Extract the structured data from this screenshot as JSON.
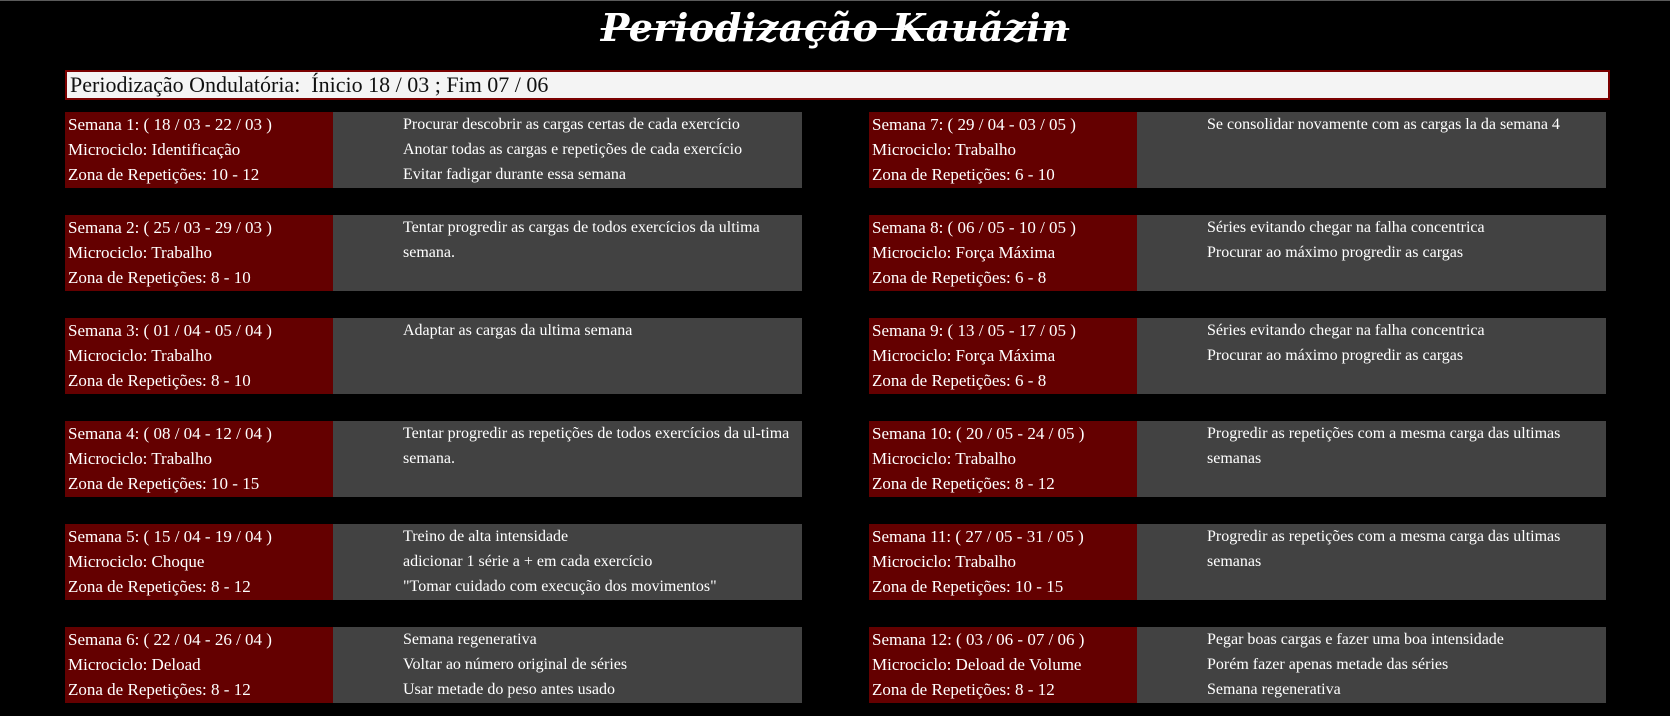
{
  "title": "Periodização Kauãzin",
  "header": "Periodização Ondulatória:  Ínicio 18 / 03 ; Fim 07 / 06",
  "weeks": [
    {
      "label": "Semana 1: ( 18 / 03 - 22 / 03 )",
      "micro": "Microciclo: Identificação",
      "zone": "Zona de Repetições: 10 - 12",
      "notes": [
        "Procurar descobrir as cargas certas de cada exercício",
        "Anotar todas as cargas e repetições de cada exercício",
        "Evitar fadigar durante essa semana"
      ]
    },
    {
      "label": "Semana 2: ( 25 / 03 - 29 / 03 )",
      "micro": "Microciclo: Trabalho",
      "zone": "Zona de Repetições: 8 - 10",
      "notes": [
        "Tentar progredir as cargas de todos exercícios da ultima semana."
      ]
    },
    {
      "label": "Semana 3: ( 01 / 04 - 05 / 04 )",
      "micro": "Microciclo: Trabalho",
      "zone": "Zona de Repetições: 8 - 10",
      "notes": [
        "Adaptar as cargas da ultima semana"
      ]
    },
    {
      "label": "Semana 4: ( 08 / 04 - 12 / 04 )",
      "micro": "Microciclo: Trabalho",
      "zone": "Zona de Repetições: 10 - 15",
      "notes": [
        "Tentar progredir as repetições de todos exercícios da ul-tima semana."
      ]
    },
    {
      "label": "Semana 5: ( 15 / 04 - 19 / 04 )",
      "micro": "Microciclo: Choque",
      "zone": "Zona de Repetições: 8 - 12",
      "notes": [
        "Treino de alta intensidade",
        "adicionar 1 série a + em cada exercício",
        "\"Tomar cuidado com execução dos movimentos\""
      ]
    },
    {
      "label": "Semana 6: ( 22 / 04 - 26 / 04 )",
      "micro": "Microciclo: Deload",
      "zone": "Zona de Repetições: 8 - 12",
      "notes": [
        "Semana regenerativa",
        "Voltar ao número original de séries",
        "Usar metade do peso antes usado"
      ]
    },
    {
      "label": "Semana 7: ( 29 / 04 - 03 / 05 )",
      "micro": "Microciclo: Trabalho",
      "zone": "Zona de Repetições: 6 - 10",
      "notes": [
        "Se consolidar novamente com as cargas la da semana 4"
      ]
    },
    {
      "label": "Semana 8: ( 06 / 05 - 10 / 05 )",
      "micro": "Microciclo: Força Máxima",
      "zone": "Zona de Repetições: 6 - 8",
      "notes": [
        "Séries evitando chegar na falha concentrica",
        "Procurar ao máximo progredir as cargas"
      ]
    },
    {
      "label": "Semana 9: ( 13 / 05 - 17 / 05 )",
      "micro": "Microciclo: Força Máxima",
      "zone": "Zona de Repetições: 6 - 8",
      "notes": [
        "Séries evitando chegar na falha concentrica",
        "Procurar ao máximo progredir as cargas"
      ]
    },
    {
      "label": "Semana 10: ( 20 / 05 - 24 / 05 )",
      "micro": "Microciclo: Trabalho",
      "zone": "Zona de Repetições: 8 - 12",
      "notes": [
        "Progredir as repetições com a mesma carga das ultimas semanas"
      ]
    },
    {
      "label": "Semana 11: ( 27 / 05 - 31 / 05 )",
      "micro": "Microciclo: Trabalho",
      "zone": "Zona de Repetições: 10 - 15",
      "notes": [
        "Progredir as repetições com a mesma carga das ultimas semanas"
      ]
    },
    {
      "label": "Semana 12: ( 03 / 06 - 07 / 06 )",
      "micro": "Microciclo: Deload de Volume",
      "zone": "Zona de Repetições: 8 - 12",
      "notes": [
        "Pegar boas cargas e fazer uma boa intensidade",
        "Porém fazer apenas metade das séries",
        "Semana regenerativa"
      ]
    }
  ],
  "colors": {
    "background": "#000000",
    "info_panel": "#640000",
    "notes_panel": "#424242",
    "header_border": "#7a0000"
  }
}
